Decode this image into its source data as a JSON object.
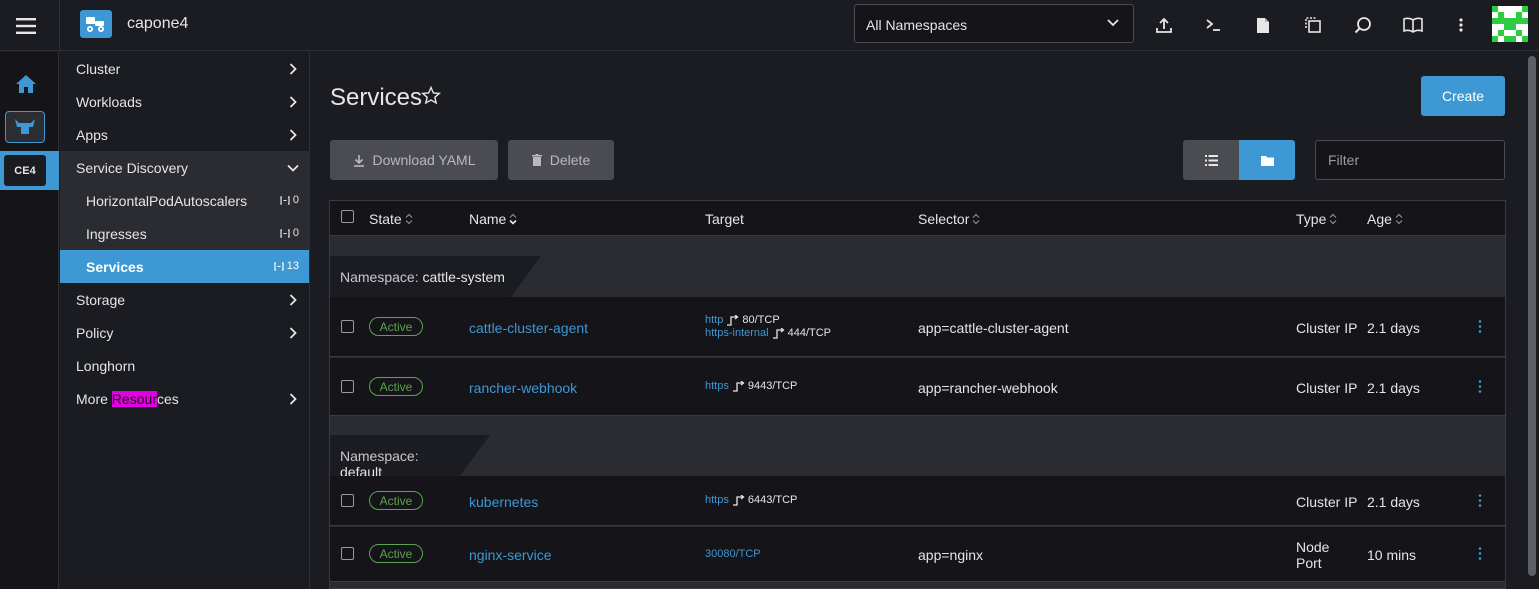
{
  "header": {
    "cluster_name": "capone4",
    "namespace_select": "All Namespaces",
    "icons": [
      "import-yaml-icon",
      "kubectl-shell-icon",
      "kubeconfig-file-icon",
      "copy-kubeconfig-icon",
      "search-icon",
      "docs-book-icon",
      "more-vertical-icon"
    ]
  },
  "rail": {
    "cluster_badge": "CE4"
  },
  "nav": {
    "items": [
      {
        "label": "Cluster"
      },
      {
        "label": "Workloads"
      },
      {
        "label": "Apps"
      },
      {
        "label": "Service Discovery"
      },
      {
        "label": "Storage"
      },
      {
        "label": "Policy"
      },
      {
        "label": "Longhorn"
      },
      {
        "label_pre": "More ",
        "label_hl": "Resour",
        "label_post": "ces"
      }
    ],
    "sub_items": [
      {
        "label": "HorizontalPodAutoscalers",
        "count": "0"
      },
      {
        "label": "Ingresses",
        "count": "0"
      },
      {
        "label": "Services",
        "count": "13"
      }
    ]
  },
  "page": {
    "title": "Services",
    "create_label": "Create",
    "download_yaml_label": "Download YAML",
    "delete_label": "Delete",
    "filter_placeholder": "Filter"
  },
  "table": {
    "columns": [
      "State",
      "Name",
      "Target",
      "Selector",
      "Type",
      "Age"
    ],
    "groups": [
      {
        "label": "Namespace:",
        "name": "cattle-system",
        "rows": [
          {
            "state": "Active",
            "name": "cattle-cluster-agent",
            "targets": [
              {
                "proto": "http",
                "port": "80/TCP"
              },
              {
                "proto": "https-internal",
                "port": "444/TCP"
              }
            ],
            "selector": "app=cattle-cluster-agent",
            "type": "Cluster IP",
            "age": "2.1 days"
          },
          {
            "state": "Active",
            "name": "rancher-webhook",
            "targets": [
              {
                "proto": "https",
                "port": "9443/TCP"
              }
            ],
            "selector": "app=rancher-webhook",
            "type": "Cluster IP",
            "age": "2.1 days"
          }
        ]
      },
      {
        "label": "Namespace:",
        "name": "default",
        "rows": [
          {
            "state": "Active",
            "name": "kubernetes",
            "targets": [
              {
                "proto": "https",
                "port": "6443/TCP"
              }
            ],
            "selector": "",
            "type": "Cluster IP",
            "age": "2.1 days"
          },
          {
            "state": "Active",
            "name": "nginx-service",
            "target_link": "30080/TCP",
            "selector": "app=nginx",
            "type_line1": "Node",
            "type_line2": "Port",
            "age": "10 mins"
          }
        ]
      }
    ]
  },
  "colors": {
    "accent": "#3d98d3",
    "active_green": "#5ba350",
    "background": "#1b1c21",
    "highlight": "#e100e1"
  }
}
